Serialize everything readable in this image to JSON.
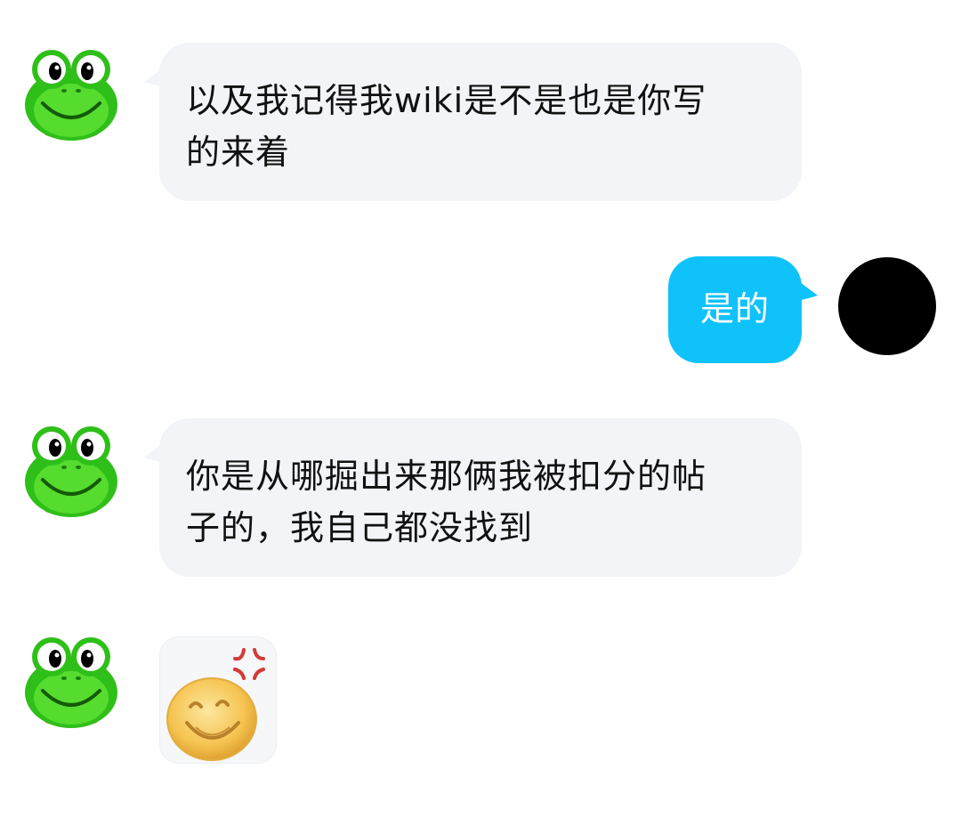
{
  "colors": {
    "incoming_bubble": "#f3f4f8",
    "outgoing_bubble": "#10c2fa",
    "incoming_text": "#111111",
    "outgoing_text": "#ffffff",
    "self_avatar": "#000000",
    "frog_green": "#35c21a"
  },
  "contact": {
    "avatar_icon": "frog-avatar-icon"
  },
  "self": {
    "avatar_icon": "black-circle-avatar"
  },
  "messages": [
    {
      "direction": "incoming",
      "text_line1": "以及我记得我wiki是不是也是你写",
      "text_line2": "的来着"
    },
    {
      "direction": "outgoing",
      "text_line1": "是的"
    },
    {
      "direction": "incoming",
      "text_line1": "你是从哪掘出来那俩我被扣分的帖",
      "text_line2": "子的，我自己都没找到"
    },
    {
      "direction": "incoming",
      "type": "sticker",
      "sticker_icon": "angry-grin-emoji-sticker"
    }
  ]
}
